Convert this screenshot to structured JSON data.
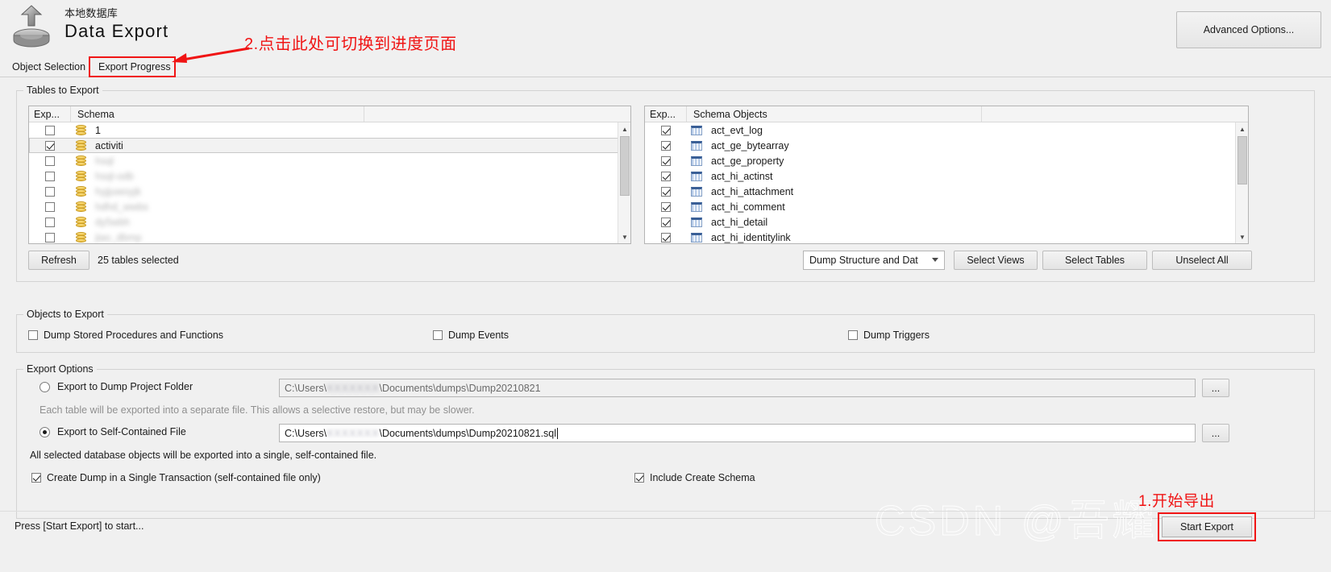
{
  "header": {
    "subtitle": "本地数据库",
    "title": "Data Export",
    "advanced_options_label": "Advanced Options...",
    "icon": "export-upload-icon"
  },
  "annotations": {
    "tab_note": "2.点击此处可切换到进度页面",
    "start_note": "1.开始导出",
    "highlight_color": "#f01414"
  },
  "watermark": {
    "text": "CSDN @吾耀"
  },
  "tabs": [
    {
      "label": "Object Selection",
      "selected": true
    },
    {
      "label": "Export Progress",
      "selected": false
    }
  ],
  "tables_group": {
    "label": "Tables to Export",
    "left_list": {
      "columns": [
        "Exp...",
        "Schema"
      ],
      "rows": [
        {
          "label": "1",
          "checked": false,
          "blurred": false,
          "selected": false
        },
        {
          "label": "activiti",
          "checked": true,
          "blurred": false,
          "selected": true
        },
        {
          "label": "hsql",
          "checked": false,
          "blurred": true,
          "selected": false
        },
        {
          "label": "hsql-odb",
          "checked": false,
          "blurred": true,
          "selected": false
        },
        {
          "label": "hyjjuwoyjk",
          "checked": false,
          "blurred": true,
          "selected": false
        },
        {
          "label": "hdhd_wwbs",
          "checked": false,
          "blurred": true,
          "selected": false
        },
        {
          "label": "dy5wbh",
          "checked": false,
          "blurred": true,
          "selected": false
        },
        {
          "label": "jiao_dbmp",
          "checked": false,
          "blurred": true,
          "selected": false
        }
      ]
    },
    "right_list": {
      "columns": [
        "Exp...",
        "Schema Objects"
      ],
      "rows": [
        {
          "label": "act_evt_log",
          "checked": true
        },
        {
          "label": "act_ge_bytearray",
          "checked": true
        },
        {
          "label": "act_ge_property",
          "checked": true
        },
        {
          "label": "act_hi_actinst",
          "checked": true
        },
        {
          "label": "act_hi_attachment",
          "checked": true
        },
        {
          "label": "act_hi_comment",
          "checked": true
        },
        {
          "label": "act_hi_detail",
          "checked": true
        },
        {
          "label": "act_hi_identitylink",
          "checked": true
        }
      ]
    },
    "refresh_label": "Refresh",
    "tables_selected_text": "25 tables selected",
    "dump_mode_value": "Dump Structure and Dat",
    "select_views_label": "Select Views",
    "select_tables_label": "Select Tables",
    "unselect_all_label": "Unselect All"
  },
  "objects_group": {
    "label": "Objects to Export",
    "checkboxes": [
      {
        "label": "Dump Stored Procedures and Functions",
        "checked": false
      },
      {
        "label": "Dump Events",
        "checked": false
      },
      {
        "label": "Dump Triggers",
        "checked": false
      }
    ]
  },
  "export_options": {
    "label": "Export Options",
    "project_folder": {
      "radio_label": "Export to Dump Project Folder",
      "selected": false,
      "path_prefix": "C:\\Users\\",
      "path_redacted": "XXXXXXX",
      "path_suffix": "\\Documents\\dumps\\Dump20210821",
      "hint": "Each table will be exported into a separate file. This allows a selective restore, but may be slower.",
      "browse_label": "..."
    },
    "self_contained": {
      "radio_label": "Export to Self-Contained File",
      "selected": true,
      "path_prefix": "C:\\Users\\",
      "path_redacted": "XXXXXXX",
      "path_suffix": "\\Documents\\dumps\\Dump20210821.sql",
      "hint": "All selected database objects will be exported into a single, self-contained file.",
      "browse_label": "..."
    },
    "bottom_checkboxes": [
      {
        "label": "Create Dump in a Single Transaction (self-contained file only)",
        "checked": true
      },
      {
        "label": "Include Create Schema",
        "checked": true
      }
    ]
  },
  "status": {
    "text": "Press [Start Export] to start..."
  },
  "start_export": {
    "label": "Start Export"
  }
}
